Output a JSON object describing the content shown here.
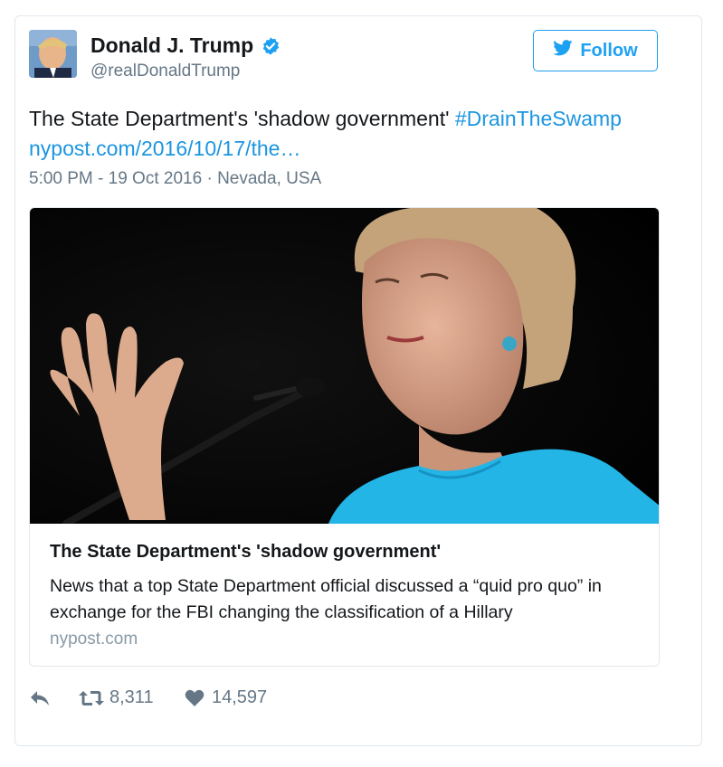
{
  "tweet": {
    "author_name": "Donald J. Trump",
    "author_handle": "@realDonaldTrump",
    "follow_label": "Follow",
    "text_plain": "The State Department's 'shadow government' ",
    "hashtag": "#DrainTheSwamp",
    "url_text": "nypost.com/2016/10/17/the…",
    "timestamp": "5:00 PM - 19 Oct 2016",
    "separator": "·",
    "location": "Nevada, USA"
  },
  "link_card": {
    "title": "The State Department's 'shadow government'",
    "description": "News that a top State Department official discussed a “quid pro quo” in exchange for the FBI changing the classification of a Hillary",
    "domain": "nypost.com"
  },
  "actions": {
    "retweet_count": "8,311",
    "like_count": "14,597"
  },
  "colors": {
    "accent": "#1da1f2",
    "link": "#1b95e0",
    "muted": "#657786",
    "border": "#e1e8ed"
  },
  "icons": [
    "verified-badge-icon",
    "twitter-bird-icon",
    "reply-icon",
    "retweet-icon",
    "heart-icon"
  ]
}
